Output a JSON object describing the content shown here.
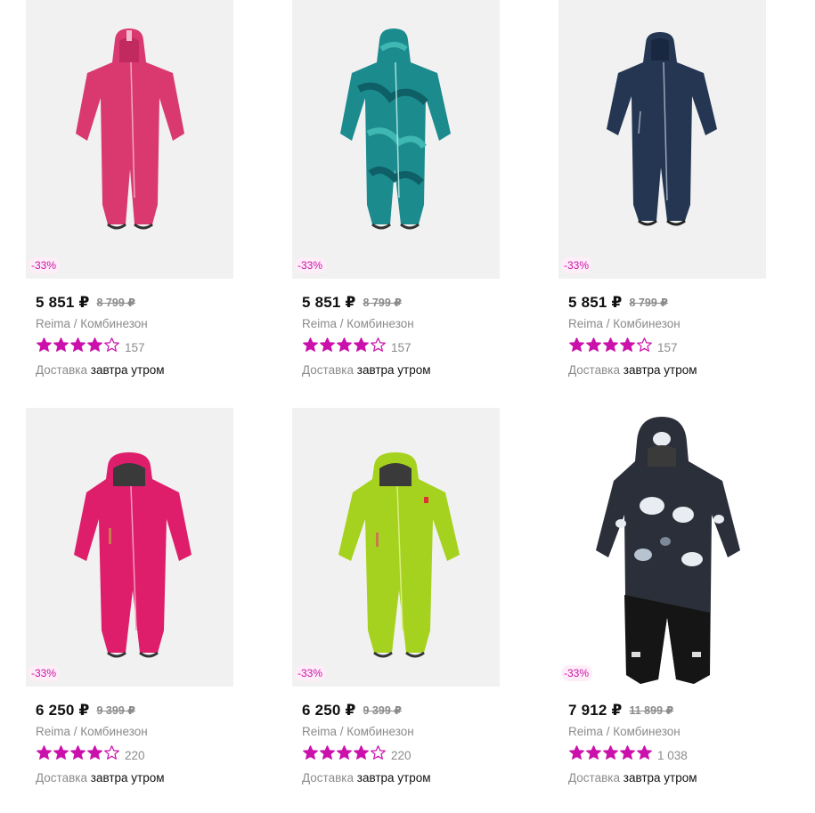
{
  "colors": {
    "accent": "#cb11ab",
    "badge_bg": "#ffeef8",
    "muted": "#8b8b8b"
  },
  "products": [
    {
      "price": "5 851 ₽",
      "old_price": "8 799 ₽",
      "discount": "-33%",
      "brand": "Reima / Комбинезон",
      "stars": 4,
      "reviews": "157",
      "delivery_label": "Доставка",
      "delivery_time": "завтра утром",
      "color": "pink"
    },
    {
      "price": "5 851 ₽",
      "old_price": "8 799 ₽",
      "discount": "-33%",
      "brand": "Reima / Комбинезон",
      "stars": 4,
      "reviews": "157",
      "delivery_label": "Доставка",
      "delivery_time": "завтра утром",
      "color": "teal-print"
    },
    {
      "price": "5 851 ₽",
      "old_price": "8 799 ₽",
      "discount": "-33%",
      "brand": "Reima / Комбинезон",
      "stars": 4,
      "reviews": "157",
      "delivery_label": "Доставка",
      "delivery_time": "завтра утром",
      "color": "navy"
    },
    {
      "price": "6 250 ₽",
      "old_price": "9 399 ₽",
      "discount": "-33%",
      "brand": "Reima / Комбинезон",
      "stars": 4,
      "reviews": "220",
      "delivery_label": "Доставка",
      "delivery_time": "завтра утром",
      "color": "raspberry"
    },
    {
      "price": "6 250 ₽",
      "old_price": "9 399 ₽",
      "discount": "-33%",
      "brand": "Reima / Комбинезон",
      "stars": 4,
      "reviews": "220",
      "delivery_label": "Доставка",
      "delivery_time": "завтра утром",
      "color": "lime"
    },
    {
      "price": "7 912 ₽",
      "old_price": "11 899 ₽",
      "discount": "-33%",
      "brand": "Reima / Комбинезон",
      "stars": 5,
      "reviews": "1 038",
      "delivery_label": "Доставка",
      "delivery_time": "завтра утром",
      "color": "black-print"
    }
  ]
}
